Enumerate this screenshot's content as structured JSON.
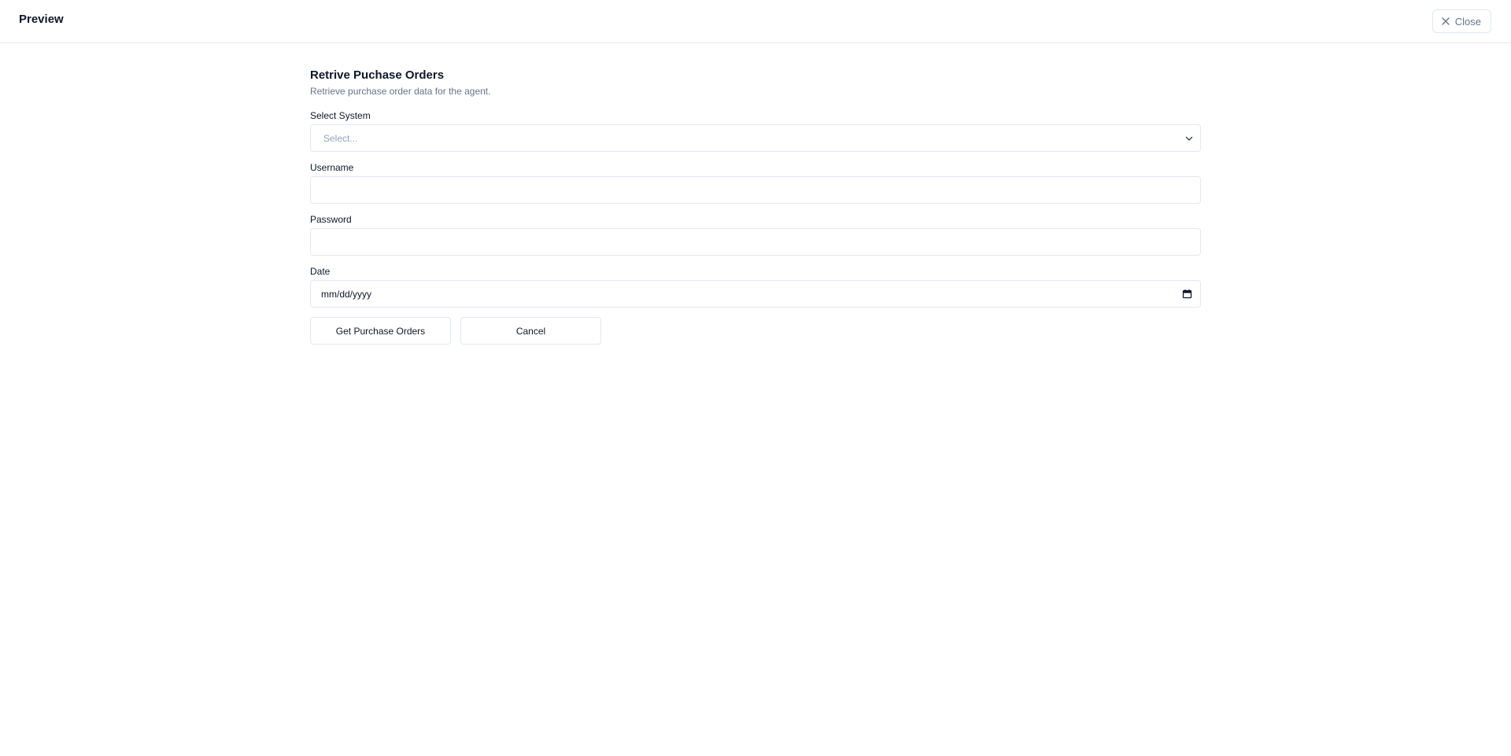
{
  "header": {
    "title": "Preview",
    "close_label": "Close"
  },
  "form": {
    "title": "Retrive Puchase Orders",
    "subtitle": "Retrieve purchase order data for the agent.",
    "system": {
      "label": "Select System",
      "placeholder": "Select..."
    },
    "username": {
      "label": "Username",
      "value": ""
    },
    "password": {
      "label": "Password",
      "value": ""
    },
    "date": {
      "label": "Date",
      "placeholder": "mm/dd/yyyy"
    },
    "submit_label": "Get Purchase Orders",
    "cancel_label": "Cancel"
  },
  "icons": {
    "close": "close-icon",
    "select": "chevron-down-icon",
    "date": "calendar-icon"
  },
  "colors": {
    "border": "#e2e8f0",
    "text": "#0f172a",
    "muted": "#64748b",
    "placeholder": "#94a3b8"
  }
}
